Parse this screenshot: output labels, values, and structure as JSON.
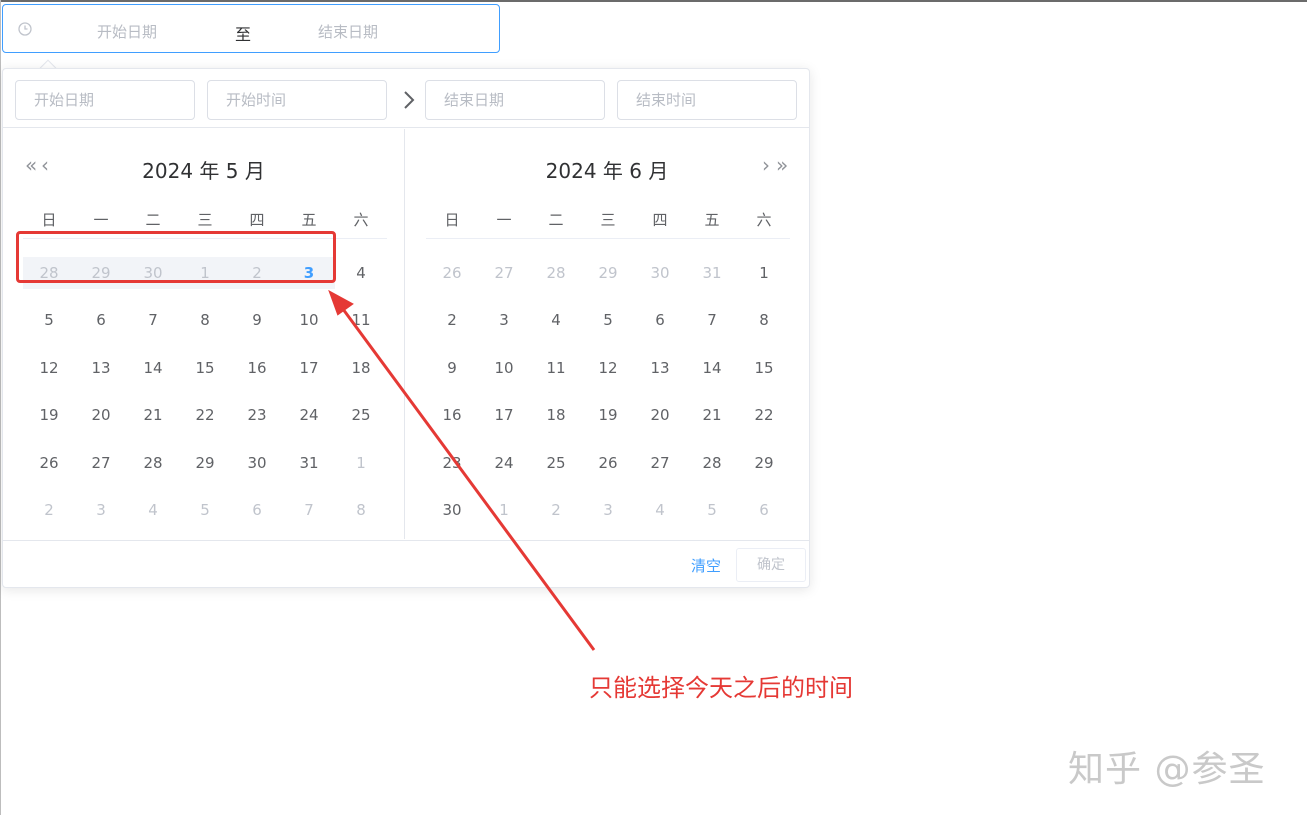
{
  "range_input": {
    "icon": "clock-icon",
    "start_placeholder": "开始日期",
    "separator": "至",
    "end_placeholder": "结束日期"
  },
  "panel": {
    "start_date_placeholder": "开始日期",
    "start_time_placeholder": "开始时间",
    "end_date_placeholder": "结束日期",
    "end_time_placeholder": "结束时间",
    "left_calendar": {
      "title": "2024 年 5 月",
      "prev_year": "«",
      "prev_month": "‹",
      "weekdays": [
        "日",
        "一",
        "二",
        "三",
        "四",
        "五",
        "六"
      ],
      "rows": [
        [
          {
            "d": "28",
            "s": "disabled"
          },
          {
            "d": "29",
            "s": "disabled"
          },
          {
            "d": "30",
            "s": "disabled"
          },
          {
            "d": "1",
            "s": "disabled"
          },
          {
            "d": "2",
            "s": "disabled"
          },
          {
            "d": "3",
            "s": "today"
          },
          {
            "d": "4",
            "s": "normal"
          }
        ],
        [
          {
            "d": "5",
            "s": "normal"
          },
          {
            "d": "6",
            "s": "normal"
          },
          {
            "d": "7",
            "s": "normal"
          },
          {
            "d": "8",
            "s": "normal"
          },
          {
            "d": "9",
            "s": "normal"
          },
          {
            "d": "10",
            "s": "normal"
          },
          {
            "d": "11",
            "s": "normal"
          }
        ],
        [
          {
            "d": "12",
            "s": "normal"
          },
          {
            "d": "13",
            "s": "normal"
          },
          {
            "d": "14",
            "s": "normal"
          },
          {
            "d": "15",
            "s": "normal"
          },
          {
            "d": "16",
            "s": "normal"
          },
          {
            "d": "17",
            "s": "normal"
          },
          {
            "d": "18",
            "s": "normal"
          }
        ],
        [
          {
            "d": "19",
            "s": "normal"
          },
          {
            "d": "20",
            "s": "normal"
          },
          {
            "d": "21",
            "s": "normal"
          },
          {
            "d": "22",
            "s": "normal"
          },
          {
            "d": "23",
            "s": "normal"
          },
          {
            "d": "24",
            "s": "normal"
          },
          {
            "d": "25",
            "s": "normal"
          }
        ],
        [
          {
            "d": "26",
            "s": "normal"
          },
          {
            "d": "27",
            "s": "normal"
          },
          {
            "d": "28",
            "s": "normal"
          },
          {
            "d": "29",
            "s": "normal"
          },
          {
            "d": "30",
            "s": "normal"
          },
          {
            "d": "31",
            "s": "normal"
          },
          {
            "d": "1",
            "s": "other"
          }
        ],
        [
          {
            "d": "2",
            "s": "other"
          },
          {
            "d": "3",
            "s": "other"
          },
          {
            "d": "4",
            "s": "other"
          },
          {
            "d": "5",
            "s": "other"
          },
          {
            "d": "6",
            "s": "other"
          },
          {
            "d": "7",
            "s": "other"
          },
          {
            "d": "8",
            "s": "other"
          }
        ]
      ]
    },
    "right_calendar": {
      "title": "2024 年 6 月",
      "next_month": "›",
      "next_year": "»",
      "weekdays": [
        "日",
        "一",
        "二",
        "三",
        "四",
        "五",
        "六"
      ],
      "rows": [
        [
          {
            "d": "26",
            "s": "other"
          },
          {
            "d": "27",
            "s": "other"
          },
          {
            "d": "28",
            "s": "other"
          },
          {
            "d": "29",
            "s": "other"
          },
          {
            "d": "30",
            "s": "other"
          },
          {
            "d": "31",
            "s": "other"
          },
          {
            "d": "1",
            "s": "normal"
          }
        ],
        [
          {
            "d": "2",
            "s": "normal"
          },
          {
            "d": "3",
            "s": "normal"
          },
          {
            "d": "4",
            "s": "normal"
          },
          {
            "d": "5",
            "s": "normal"
          },
          {
            "d": "6",
            "s": "normal"
          },
          {
            "d": "7",
            "s": "normal"
          },
          {
            "d": "8",
            "s": "normal"
          }
        ],
        [
          {
            "d": "9",
            "s": "normal"
          },
          {
            "d": "10",
            "s": "normal"
          },
          {
            "d": "11",
            "s": "normal"
          },
          {
            "d": "12",
            "s": "normal"
          },
          {
            "d": "13",
            "s": "normal"
          },
          {
            "d": "14",
            "s": "normal"
          },
          {
            "d": "15",
            "s": "normal"
          }
        ],
        [
          {
            "d": "16",
            "s": "normal"
          },
          {
            "d": "17",
            "s": "normal"
          },
          {
            "d": "18",
            "s": "normal"
          },
          {
            "d": "19",
            "s": "normal"
          },
          {
            "d": "20",
            "s": "normal"
          },
          {
            "d": "21",
            "s": "normal"
          },
          {
            "d": "22",
            "s": "normal"
          }
        ],
        [
          {
            "d": "23",
            "s": "normal"
          },
          {
            "d": "24",
            "s": "normal"
          },
          {
            "d": "25",
            "s": "normal"
          },
          {
            "d": "26",
            "s": "normal"
          },
          {
            "d": "27",
            "s": "normal"
          },
          {
            "d": "28",
            "s": "normal"
          },
          {
            "d": "29",
            "s": "normal"
          }
        ],
        [
          {
            "d": "30",
            "s": "normal"
          },
          {
            "d": "1",
            "s": "other"
          },
          {
            "d": "2",
            "s": "other"
          },
          {
            "d": "3",
            "s": "other"
          },
          {
            "d": "4",
            "s": "other"
          },
          {
            "d": "5",
            "s": "other"
          },
          {
            "d": "6",
            "s": "other"
          }
        ]
      ]
    },
    "footer": {
      "clear_label": "清空",
      "confirm_label": "确定"
    }
  },
  "annotation_text": "只能选择今天之后的时间",
  "watermark": "知乎 @参圣",
  "colors": {
    "accent": "#409eff",
    "annotation_red": "#e53935",
    "disabled_bg": "#f2f4f8"
  }
}
